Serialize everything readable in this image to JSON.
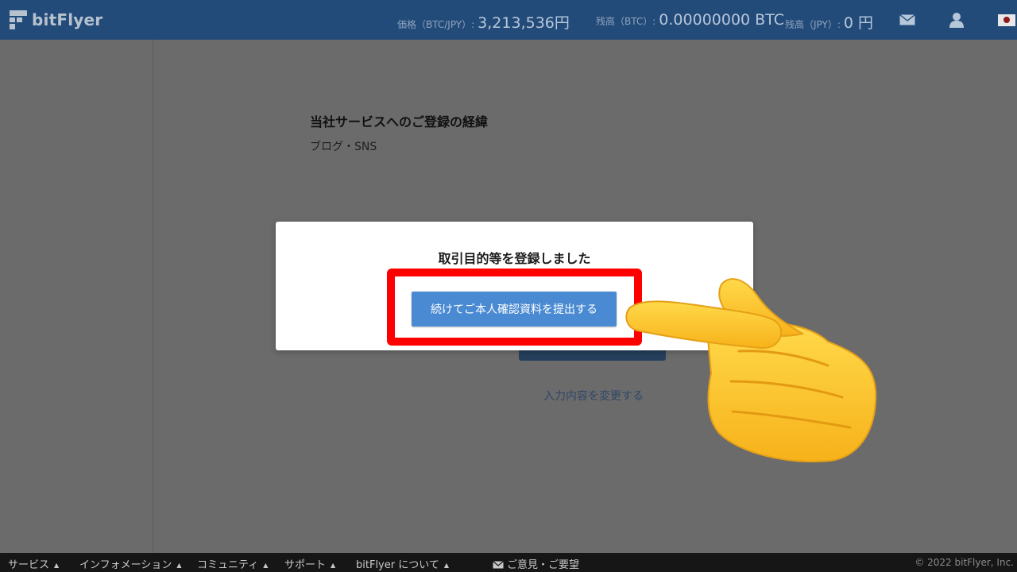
{
  "header": {
    "logo_text": "bitFlyer",
    "price": {
      "label": "価格（BTC/JPY）:",
      "value": "3,213,536円"
    },
    "balance_btc": {
      "label": "残高（BTC）:",
      "value": "0.00000000 BTC"
    },
    "balance_jpy": {
      "label": "残高（JPY）:",
      "value": "0 円"
    },
    "icons": [
      "envelope-icon",
      "user-icon",
      "japan-flag-icon"
    ]
  },
  "content": {
    "cut_text": "",
    "section_title": "当社サービスへのご登録の経緯",
    "section_value": "ブログ・SNS",
    "change_link": "入力内容を変更する"
  },
  "modal": {
    "title": "取引目的等を登録しました",
    "button_label": "続けてご本人確認資料を提出する",
    "highlight_color": "#ff0000",
    "button_color": "#4a8ad2"
  },
  "footer": {
    "items": [
      "サービス",
      "インフォメーション",
      "コミュニティ",
      "サポート",
      "bitFlyer について"
    ],
    "caret": "▲",
    "feedback": "ご意見・ご要望",
    "copyright": "© 2022 bitFlyer, Inc."
  },
  "colors": {
    "header_bg": "#234b7a",
    "overlay_bg": "#6b6b6b",
    "footer_bg": "#161616"
  }
}
